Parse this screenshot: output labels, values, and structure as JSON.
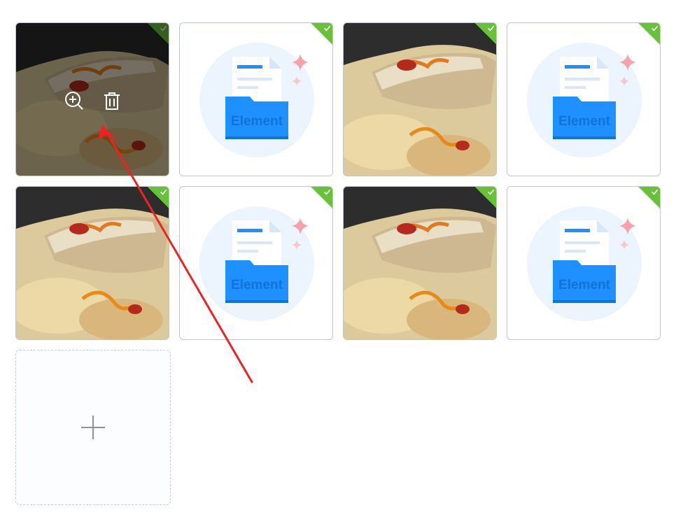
{
  "upload_list": {
    "items": [
      {
        "kind": "food-photo",
        "status": "success",
        "hovered": true
      },
      {
        "kind": "element-file",
        "status": "success",
        "label": "Element"
      },
      {
        "kind": "food-photo",
        "status": "success"
      },
      {
        "kind": "element-file",
        "status": "success",
        "label": "Element"
      },
      {
        "kind": "food-photo",
        "status": "success"
      },
      {
        "kind": "element-file",
        "status": "success",
        "label": "Element"
      },
      {
        "kind": "food-photo",
        "status": "success"
      },
      {
        "kind": "element-file",
        "status": "success",
        "label": "Element"
      }
    ],
    "hover_actions": [
      "zoom-in-icon",
      "delete-icon"
    ],
    "upload_trigger_icon": "plus-icon"
  },
  "colors": {
    "success": "#67c23a",
    "element_blue": "#1e90ff",
    "annotation_arrow": "#ee2222",
    "upload_border": "#c0ccda"
  }
}
